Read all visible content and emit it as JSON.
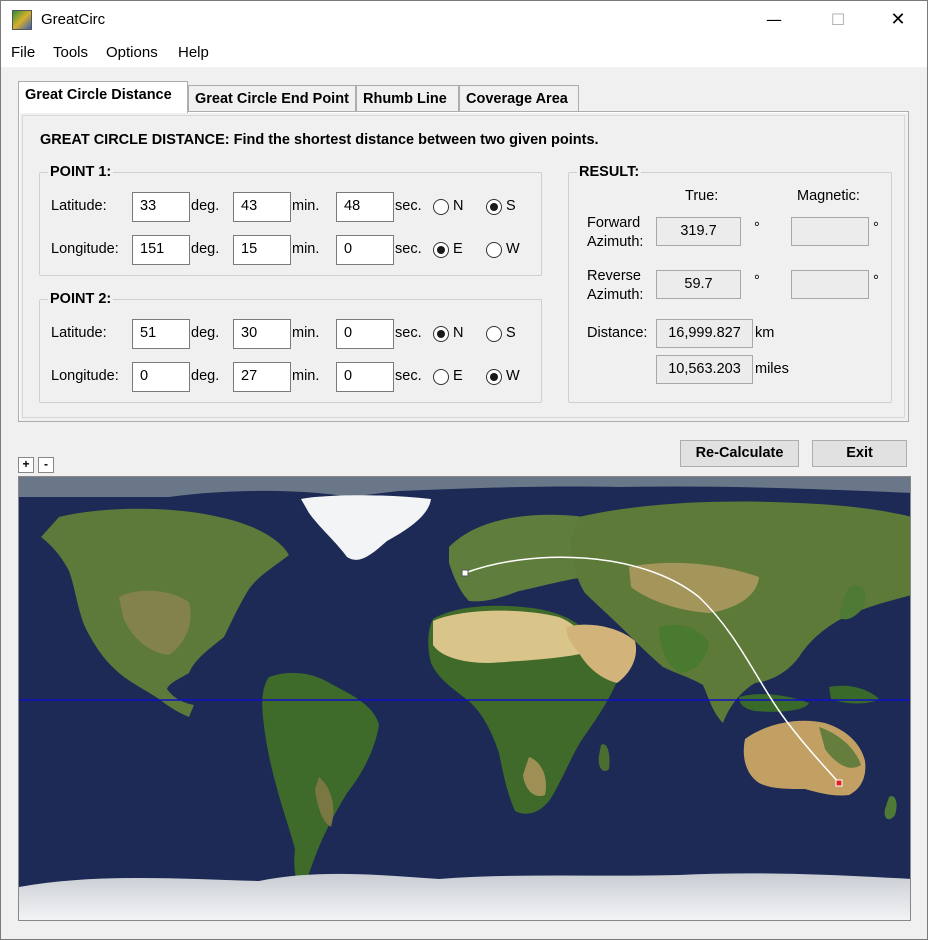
{
  "window": {
    "title": "GreatCirc",
    "minimize_glyph": "—",
    "maximize_glyph": "☐",
    "close_glyph": "✕"
  },
  "menu": [
    "File",
    "Tools",
    "Options",
    "Help"
  ],
  "tabs": [
    "Great Circle Distance",
    "Great Circle End Point",
    "Rhumb Line",
    "Coverage Area"
  ],
  "heading": "GREAT CIRCLE DISTANCE: Find the shortest distance between two given points.",
  "point1": {
    "legend": "POINT 1:",
    "lat_label": "Latitude:",
    "lat_deg": "33",
    "lat_min": "43",
    "lat_sec": "48",
    "lat_hemi": "S",
    "lon_label": "Longitude:",
    "lon_deg": "151",
    "lon_min": "15",
    "lon_sec": "0",
    "lon_hemi": "E"
  },
  "point2": {
    "legend": "POINT 2:",
    "lat_label": "Latitude:",
    "lat_deg": "51",
    "lat_min": "30",
    "lat_sec": "0",
    "lat_hemi": "N",
    "lon_label": "Longitude:",
    "lon_deg": "0",
    "lon_min": "27",
    "lon_sec": "0",
    "lon_hemi": "W"
  },
  "units": {
    "deg": "deg.",
    "min": "min.",
    "sec": "sec.",
    "N": "N",
    "S": "S",
    "E": "E",
    "W": "W"
  },
  "result": {
    "legend": "RESULT:",
    "true_header": "True:",
    "magnetic_header": "Magnetic:",
    "fwd_label_1": "Forward",
    "fwd_label_2": "Azimuth:",
    "fwd_true": "319.7",
    "fwd_magnetic": "",
    "rev_label_1": "Reverse",
    "rev_label_2": "Azimuth:",
    "rev_true": "59.7",
    "rev_magnetic": "",
    "degree_symbol": "°",
    "distance_label": "Distance:",
    "distance_km": "16,999.827",
    "km_unit": "km",
    "distance_miles": "10,563.203",
    "miles_unit": "miles"
  },
  "buttons": {
    "recalculate": "Re-Calculate",
    "exit": "Exit",
    "zoom_in": "+",
    "zoom_out": "-"
  },
  "colors": {
    "ocean": "#1c2a55",
    "equator": "#1010c8",
    "path": "#ffffff",
    "marker_end": "#e02020"
  }
}
